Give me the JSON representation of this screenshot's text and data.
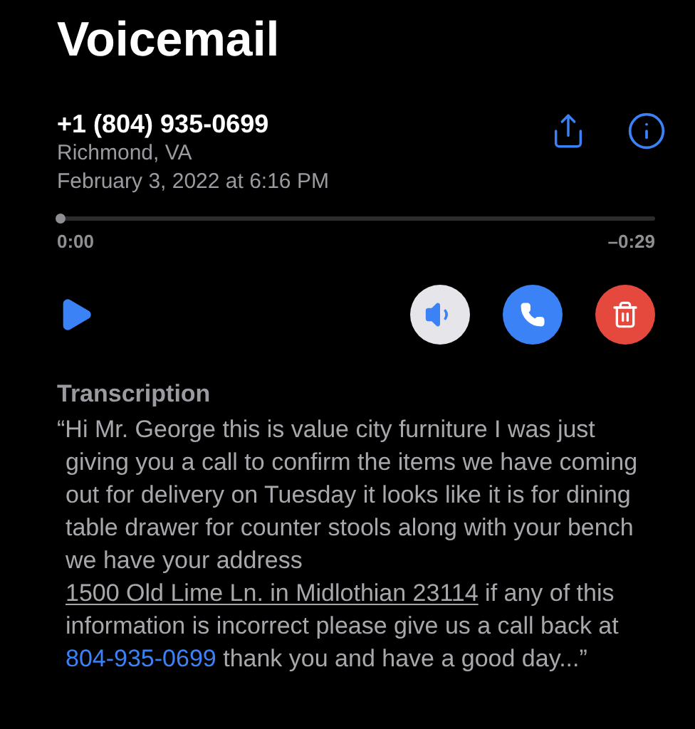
{
  "title": "Voicemail",
  "caller": {
    "number": "+1 (804) 935-0699",
    "location": "Richmond, VA",
    "date": "February 3, 2022 at 6:16 PM"
  },
  "player": {
    "level": 0,
    "elapsed": "0:00",
    "remaining": "–0:29"
  },
  "transcription": {
    "heading": "Transcription",
    "segments": [
      {
        "kind": "text",
        "text": "“Hi Mr. George this is value city furniture I was just giving you a call to confirm the items we have coming out for delivery on Tuesday it looks like it is for dining table drawer for counter stools along with your bench we have your address "
      },
      {
        "kind": "address",
        "text": "1500 Old Lime Ln. in Midlothian 23114"
      },
      {
        "kind": "text",
        "text": " if any of this information is incorrect please give us a call back at "
      },
      {
        "kind": "phone",
        "text": "804-935-0699"
      },
      {
        "kind": "text",
        "text": " thank you and have a good day...”"
      }
    ]
  }
}
